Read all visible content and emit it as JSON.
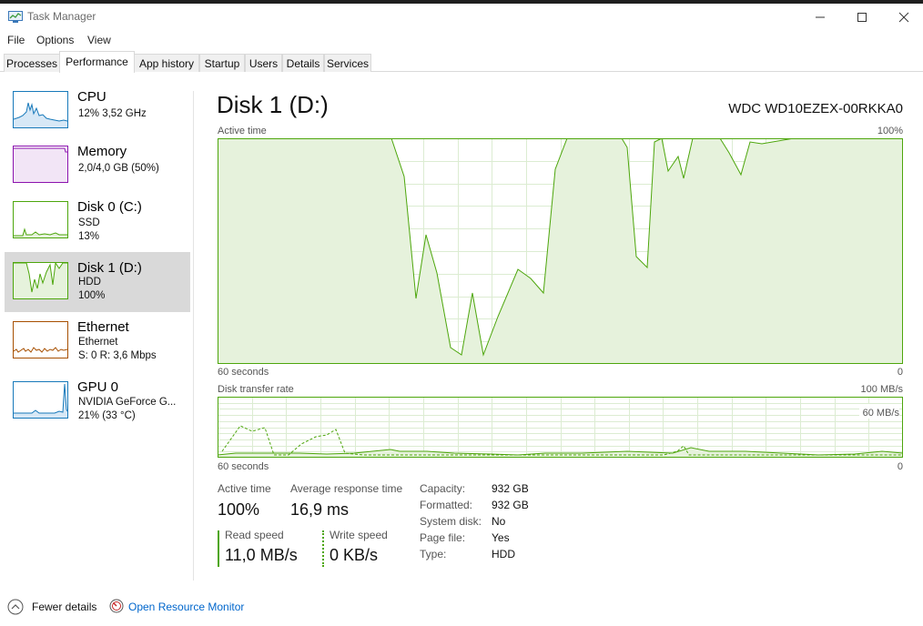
{
  "window": {
    "title": "Task Manager"
  },
  "menu": [
    "File",
    "Options",
    "View"
  ],
  "tabs": [
    "Processes",
    "Performance",
    "App history",
    "Startup",
    "Users",
    "Details",
    "Services"
  ],
  "sidebar": {
    "items": [
      {
        "title": "CPU",
        "lines": [
          "12% 3,52 GHz"
        ]
      },
      {
        "title": "Memory",
        "lines": [
          "2,0/4,0 GB (50%)"
        ]
      },
      {
        "title": "Disk 0 (C:)",
        "lines": [
          "SSD",
          "13%"
        ]
      },
      {
        "title": "Disk 1 (D:)",
        "lines": [
          "HDD",
          "100%"
        ]
      },
      {
        "title": "Ethernet",
        "lines": [
          "Ethernet",
          "S: 0 R: 3,6 Mbps"
        ]
      },
      {
        "title": "GPU 0",
        "lines": [
          "NVIDIA GeForce G...",
          "21% (33 °C)"
        ]
      }
    ]
  },
  "main": {
    "title": "Disk 1 (D:)",
    "device": "WDC WD10EZEX-00RKKA0",
    "active_graph": {
      "label": "Active time",
      "max_label": "100%",
      "time_label": "60 seconds",
      "min_label": "0"
    },
    "transfer_graph": {
      "label": "Disk transfer rate",
      "max_label": "100 MB/s",
      "mid_label": "60 MB/s",
      "time_label": "60 seconds",
      "min_label": "0"
    },
    "stats": {
      "active_time_label": "Active time",
      "active_time_value": "100%",
      "response_label": "Average response time",
      "response_value": "16,9 ms",
      "read_label": "Read speed",
      "read_value": "11,0 MB/s",
      "write_label": "Write speed",
      "write_value": "0 KB/s"
    },
    "properties": [
      {
        "label": "Capacity:",
        "value": "932 GB"
      },
      {
        "label": "Formatted:",
        "value": "932 GB"
      },
      {
        "label": "System disk:",
        "value": "No"
      },
      {
        "label": "Page file:",
        "value": "Yes"
      },
      {
        "label": "Type:",
        "value": "HDD"
      }
    ]
  },
  "footer": {
    "fewer_details": "Fewer details",
    "resource_monitor": "Open Resource Monitor"
  },
  "colors": {
    "disk_green": "#4da60c",
    "cpu_blue": "#1779ba",
    "memory_purple": "#8b12ae",
    "ethernet_orange": "#a74f01",
    "link_blue": "#0066cc",
    "selected_bg": "#d9d9d9"
  }
}
